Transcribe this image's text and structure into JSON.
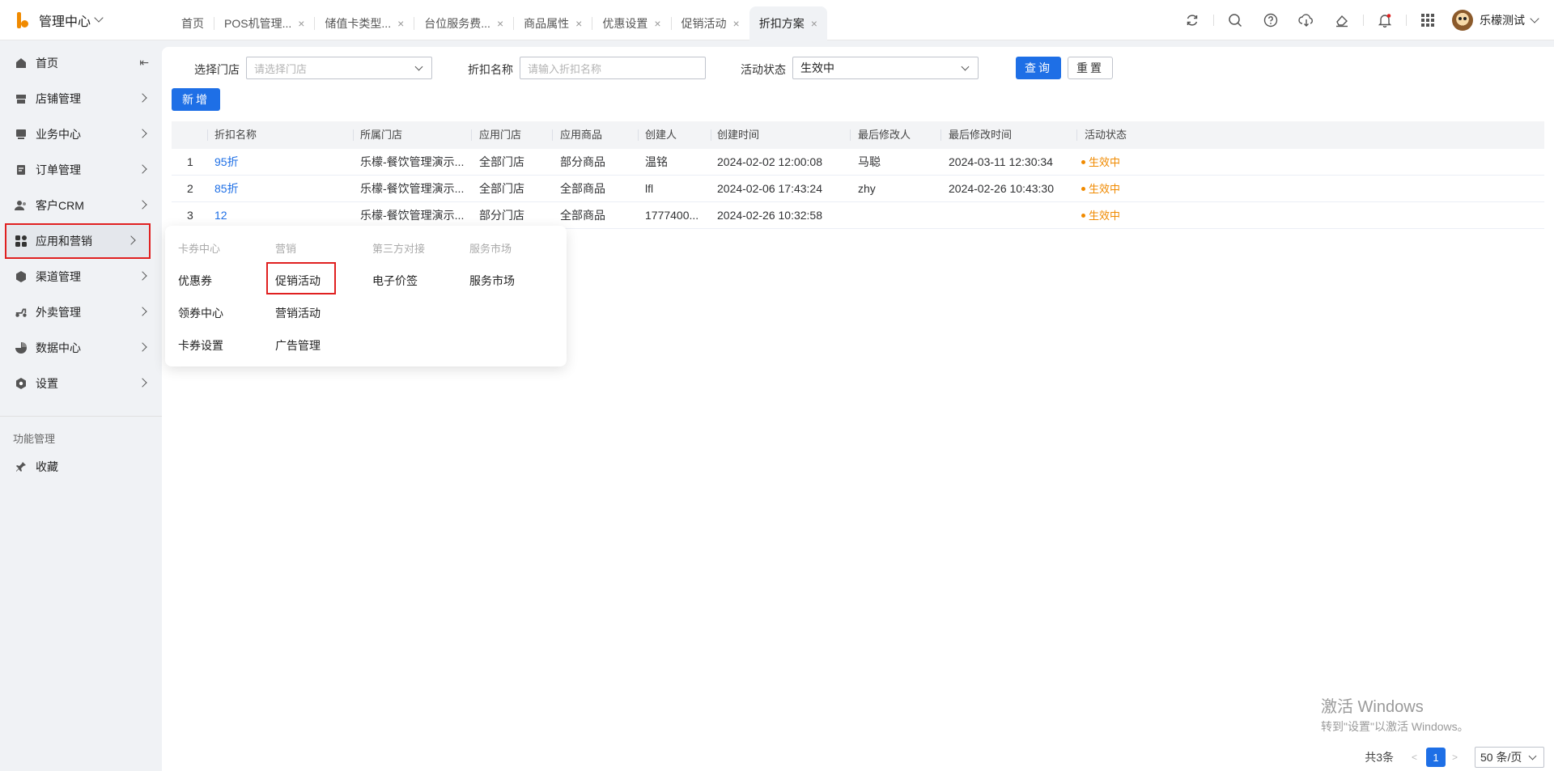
{
  "brand": {
    "title": "管理中心"
  },
  "tabs": [
    {
      "label": "首页",
      "closable": false
    },
    {
      "label": "POS机管理...",
      "closable": true
    },
    {
      "label": "储值卡类型...",
      "closable": true
    },
    {
      "label": "台位服务费...",
      "closable": true
    },
    {
      "label": "商品属性",
      "closable": true
    },
    {
      "label": "优惠设置",
      "closable": true
    },
    {
      "label": "促销活动",
      "closable": true
    },
    {
      "label": "折扣方案",
      "closable": true,
      "active": true
    }
  ],
  "tab_close_glyph": "×",
  "user": {
    "name": "乐檬测试"
  },
  "sidebar": {
    "items": [
      {
        "label": "首页",
        "icon": "home-icon"
      },
      {
        "label": "店铺管理",
        "icon": "store-icon"
      },
      {
        "label": "业务中心",
        "icon": "business-icon"
      },
      {
        "label": "订单管理",
        "icon": "order-icon"
      },
      {
        "label": "客户CRM",
        "icon": "customer-icon"
      },
      {
        "label": "应用和营销",
        "icon": "apps-icon"
      },
      {
        "label": "渠道管理",
        "icon": "channel-icon"
      },
      {
        "label": "外卖管理",
        "icon": "delivery-icon"
      },
      {
        "label": "数据中心",
        "icon": "data-icon"
      },
      {
        "label": "设置",
        "icon": "settings-icon"
      }
    ],
    "section_label": "功能管理",
    "favorites_label": "收藏"
  },
  "filters": {
    "store_label": "选择门店",
    "store_placeholder": "请选择门店",
    "name_label": "折扣名称",
    "name_placeholder": "请输入折扣名称",
    "status_label": "活动状态",
    "status_value": "生效中",
    "query_label": "查询",
    "reset_label": "重置",
    "add_label": "新增"
  },
  "table": {
    "columns": [
      "折扣名称",
      "所属门店",
      "应用门店",
      "应用商品",
      "创建人",
      "创建时间",
      "最后修改人",
      "最后修改时间",
      "活动状态"
    ],
    "rows": [
      {
        "index": "1",
        "name": "95折",
        "store": "乐檬-餐饮管理演示...",
        "apply_store": "全部门店",
        "apply_goods": "部分商品",
        "creator": "温铭",
        "created": "2024-02-02 12:00:08",
        "modifier": "马聪",
        "modified": "2024-03-11 12:30:34",
        "status": "生效中"
      },
      {
        "index": "2",
        "name": "85折",
        "store": "乐檬-餐饮管理演示...",
        "apply_store": "全部门店",
        "apply_goods": "全部商品",
        "creator": "lfl",
        "created": "2024-02-06 17:43:24",
        "modifier": "zhy",
        "modified": "2024-02-26 10:43:30",
        "status": "生效中"
      },
      {
        "index": "3",
        "name": "12",
        "store": "乐檬-餐饮管理演示...",
        "apply_store": "部分门店",
        "apply_goods": "全部商品",
        "creator": "1777400...",
        "created": "2024-02-26 10:32:58",
        "modifier": "",
        "modified": "",
        "status": "生效中"
      }
    ]
  },
  "menu": {
    "columns": [
      {
        "header": "卡券中心",
        "items": [
          "优惠券",
          "领券中心",
          "卡券设置"
        ]
      },
      {
        "header": "营销",
        "items": [
          "促销活动",
          "营销活动",
          "广告管理"
        ]
      },
      {
        "header": "第三方对接",
        "items": [
          "电子价签"
        ]
      },
      {
        "header": "服务市场",
        "items": [
          "服务市场"
        ]
      }
    ]
  },
  "pagination": {
    "total": "共3条",
    "current": "1",
    "page_size": "50 条/页",
    "prev_glyph": "<",
    "next_glyph": ">"
  },
  "windows": {
    "line1": "激活 Windows",
    "line2": "转到\"设置\"以激活 Windows。"
  },
  "colors": {
    "primary": "#1e6fe6",
    "accent": "#f08a00",
    "highlight": "#e02020"
  }
}
